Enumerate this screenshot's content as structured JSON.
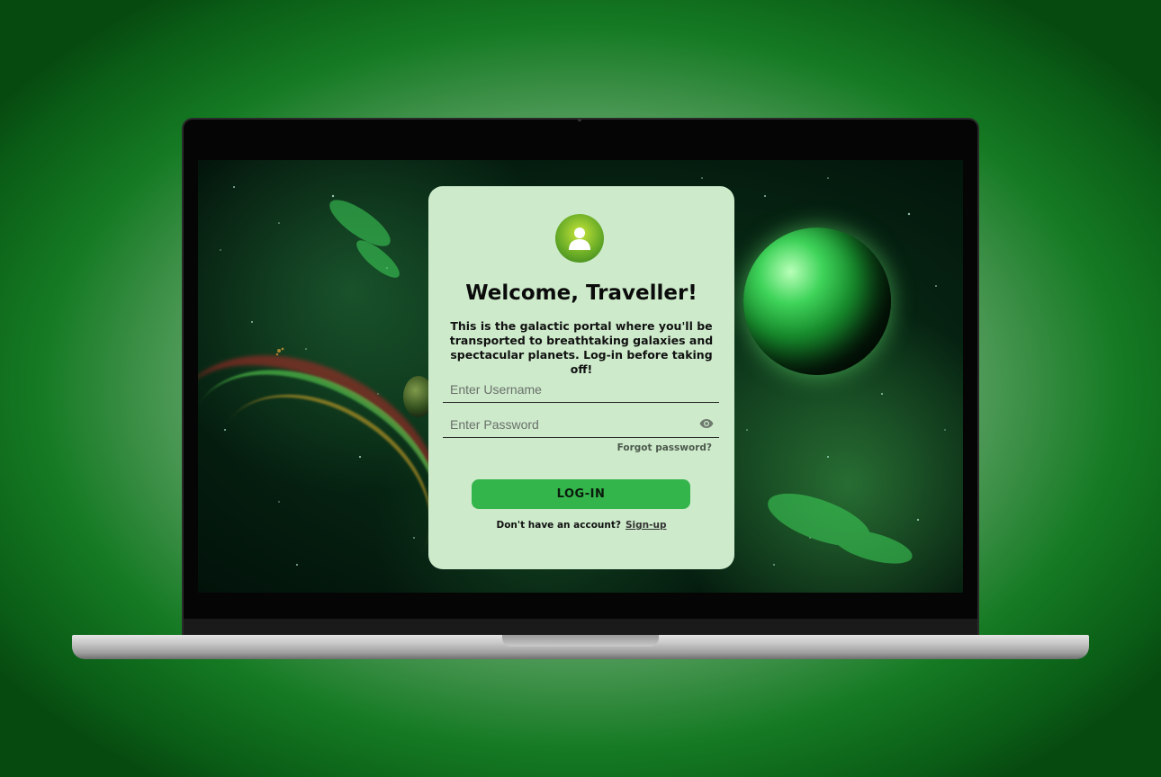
{
  "card": {
    "title": "Welcome, Traveller!",
    "subtitle": "This is the galactic portal where you'll be transported to breathtaking galaxies and spectacular planets. Log-in before taking off!",
    "username": {
      "value": "",
      "placeholder": "Enter Username"
    },
    "password": {
      "value": "",
      "placeholder": "Enter Password"
    },
    "forgot_label": "Forgot password?",
    "login_label": "LOG-IN",
    "signup_prompt": "Don't have an account?",
    "signup_label": "Sign-up"
  },
  "icons": {
    "avatar": "user-icon",
    "password_toggle": "eye-icon"
  },
  "colors": {
    "card_bg": "#cdebcb",
    "button_bg": "#34b54b",
    "accent": "#1a7f2a"
  }
}
